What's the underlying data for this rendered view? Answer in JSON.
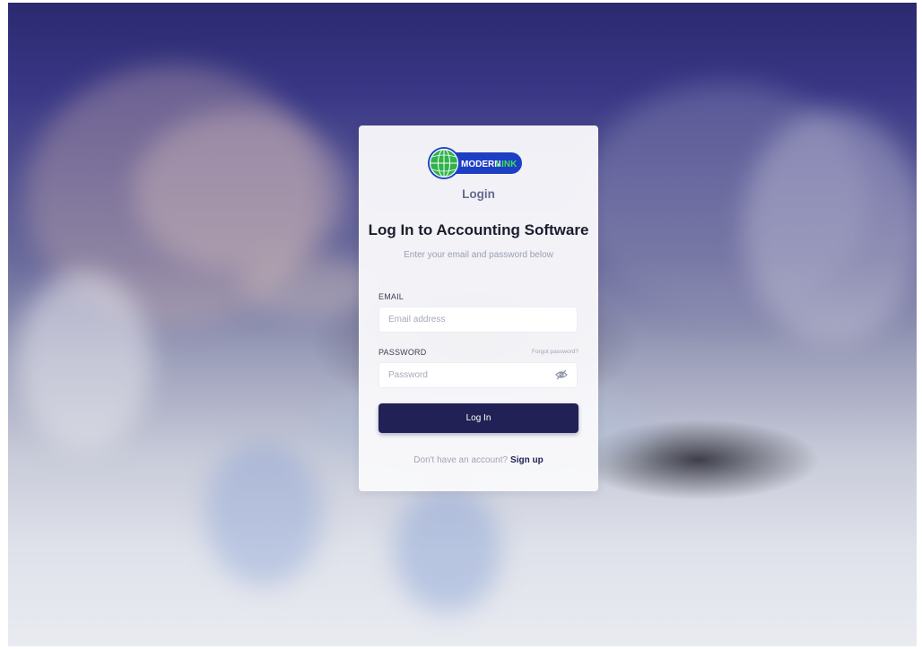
{
  "brand": {
    "logo_text": "MODERN LINK",
    "logo_text_parts": [
      "MODERN",
      "LINK"
    ],
    "colors": {
      "globe_green": "#2fb34a",
      "badge_blue": "#1d3fc4",
      "link_green": "#3ee05a"
    }
  },
  "login": {
    "title": "Login",
    "heading": "Log In to Accounting Software",
    "subheading": "Enter your email and password below"
  },
  "form": {
    "email_label": "EMAIL",
    "email_placeholder": "Email address",
    "email_value": "",
    "password_label": "PASSWORD",
    "password_placeholder": "Password",
    "password_value": "",
    "forgot_label": "Forgot password?",
    "password_toggle_icon": "eye-off-icon",
    "submit_label": "Log In"
  },
  "signup": {
    "prompt": "Don't have an account?",
    "link_label": "Sign up"
  },
  "theme": {
    "primary": "#222155",
    "overlay": "#2b296f"
  }
}
